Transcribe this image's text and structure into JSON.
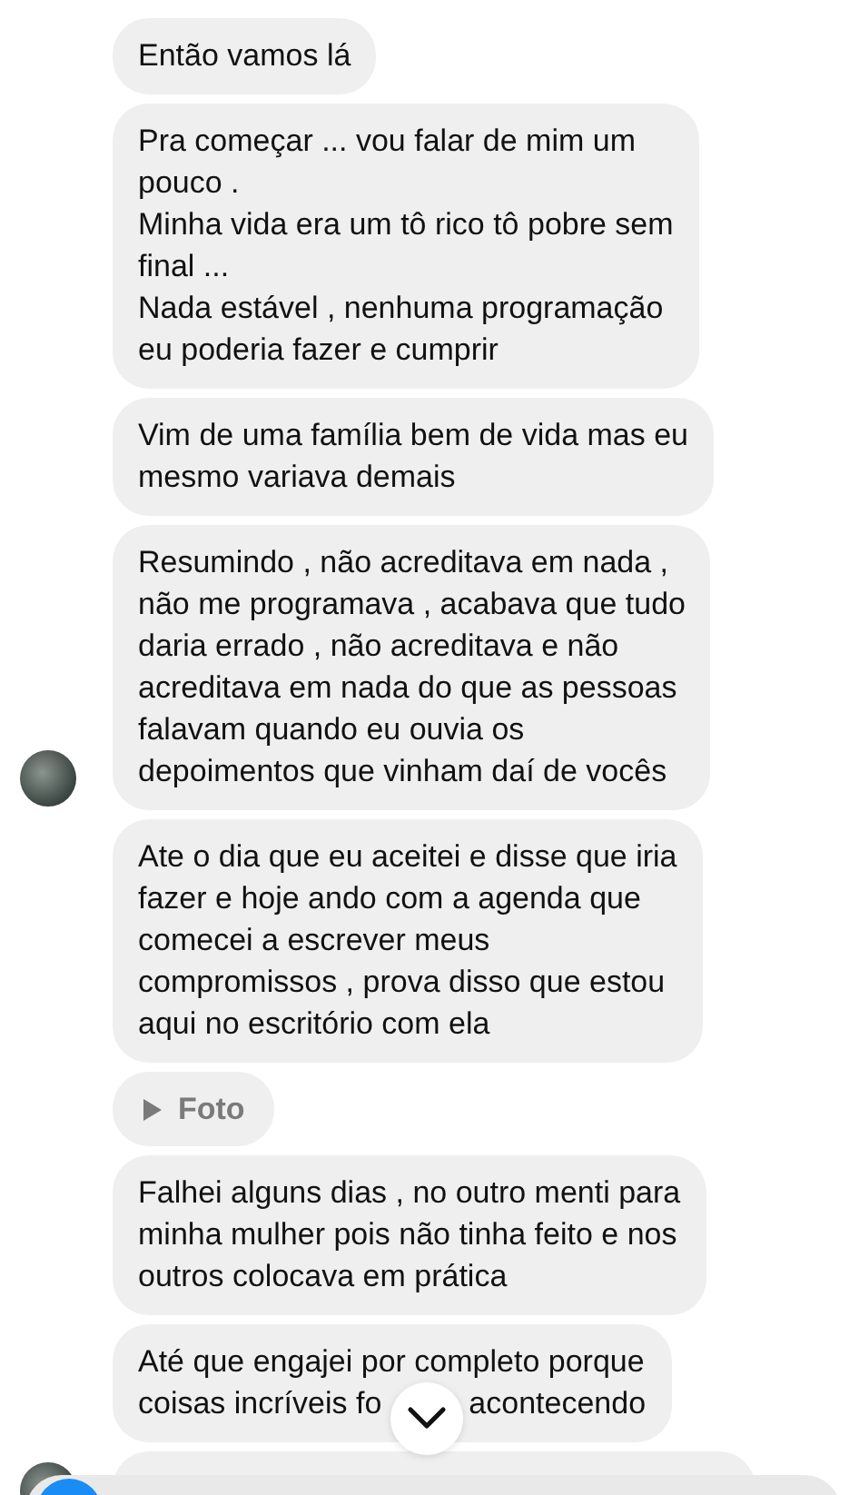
{
  "messages": [
    {
      "kind": "text",
      "text": "Então vamos lá",
      "avatar": false
    },
    {
      "kind": "text",
      "text": "Pra começar ... vou falar de mim um\npouco .\nMinha vida era um tô rico tô pobre sem\nfinal ...\nNada estável , nenhuma programação\neu poderia fazer e cumprir",
      "avatar": false
    },
    {
      "kind": "text",
      "text": "Vim de uma família bem de vida mas eu\nmesmo variava demais",
      "avatar": false
    },
    {
      "kind": "text",
      "text": "Resumindo , não acreditava em nada ,\nnão me programava , acabava que tudo\ndaria errado , não acreditava e não\nacreditava em nada do que as pessoas\nfalavam quando eu ouvia os\ndepoimentos que vinham daí de vocês",
      "avatar": true
    },
    {
      "kind": "text",
      "text": "Ate o dia que eu aceitei e disse que iria\nfazer e hoje ando com a agenda que\ncomecei a escrever meus\ncompromissos , prova disso que estou\naqui no escritório com ela",
      "avatar": false
    },
    {
      "kind": "media",
      "text": "Foto",
      "avatar": false
    },
    {
      "kind": "text",
      "text": "Falhei alguns dias , no outro menti para\nminha mulher pois não tinha feito e nos\noutros colocava em prática",
      "avatar": false
    },
    {
      "kind": "text",
      "text": "Até que engajei por completo porque\ncoisas incríveis fo",
      "text_after": "acontecendo",
      "avatar": false
    },
    {
      "kind": "cut",
      "avatar": true
    }
  ]
}
